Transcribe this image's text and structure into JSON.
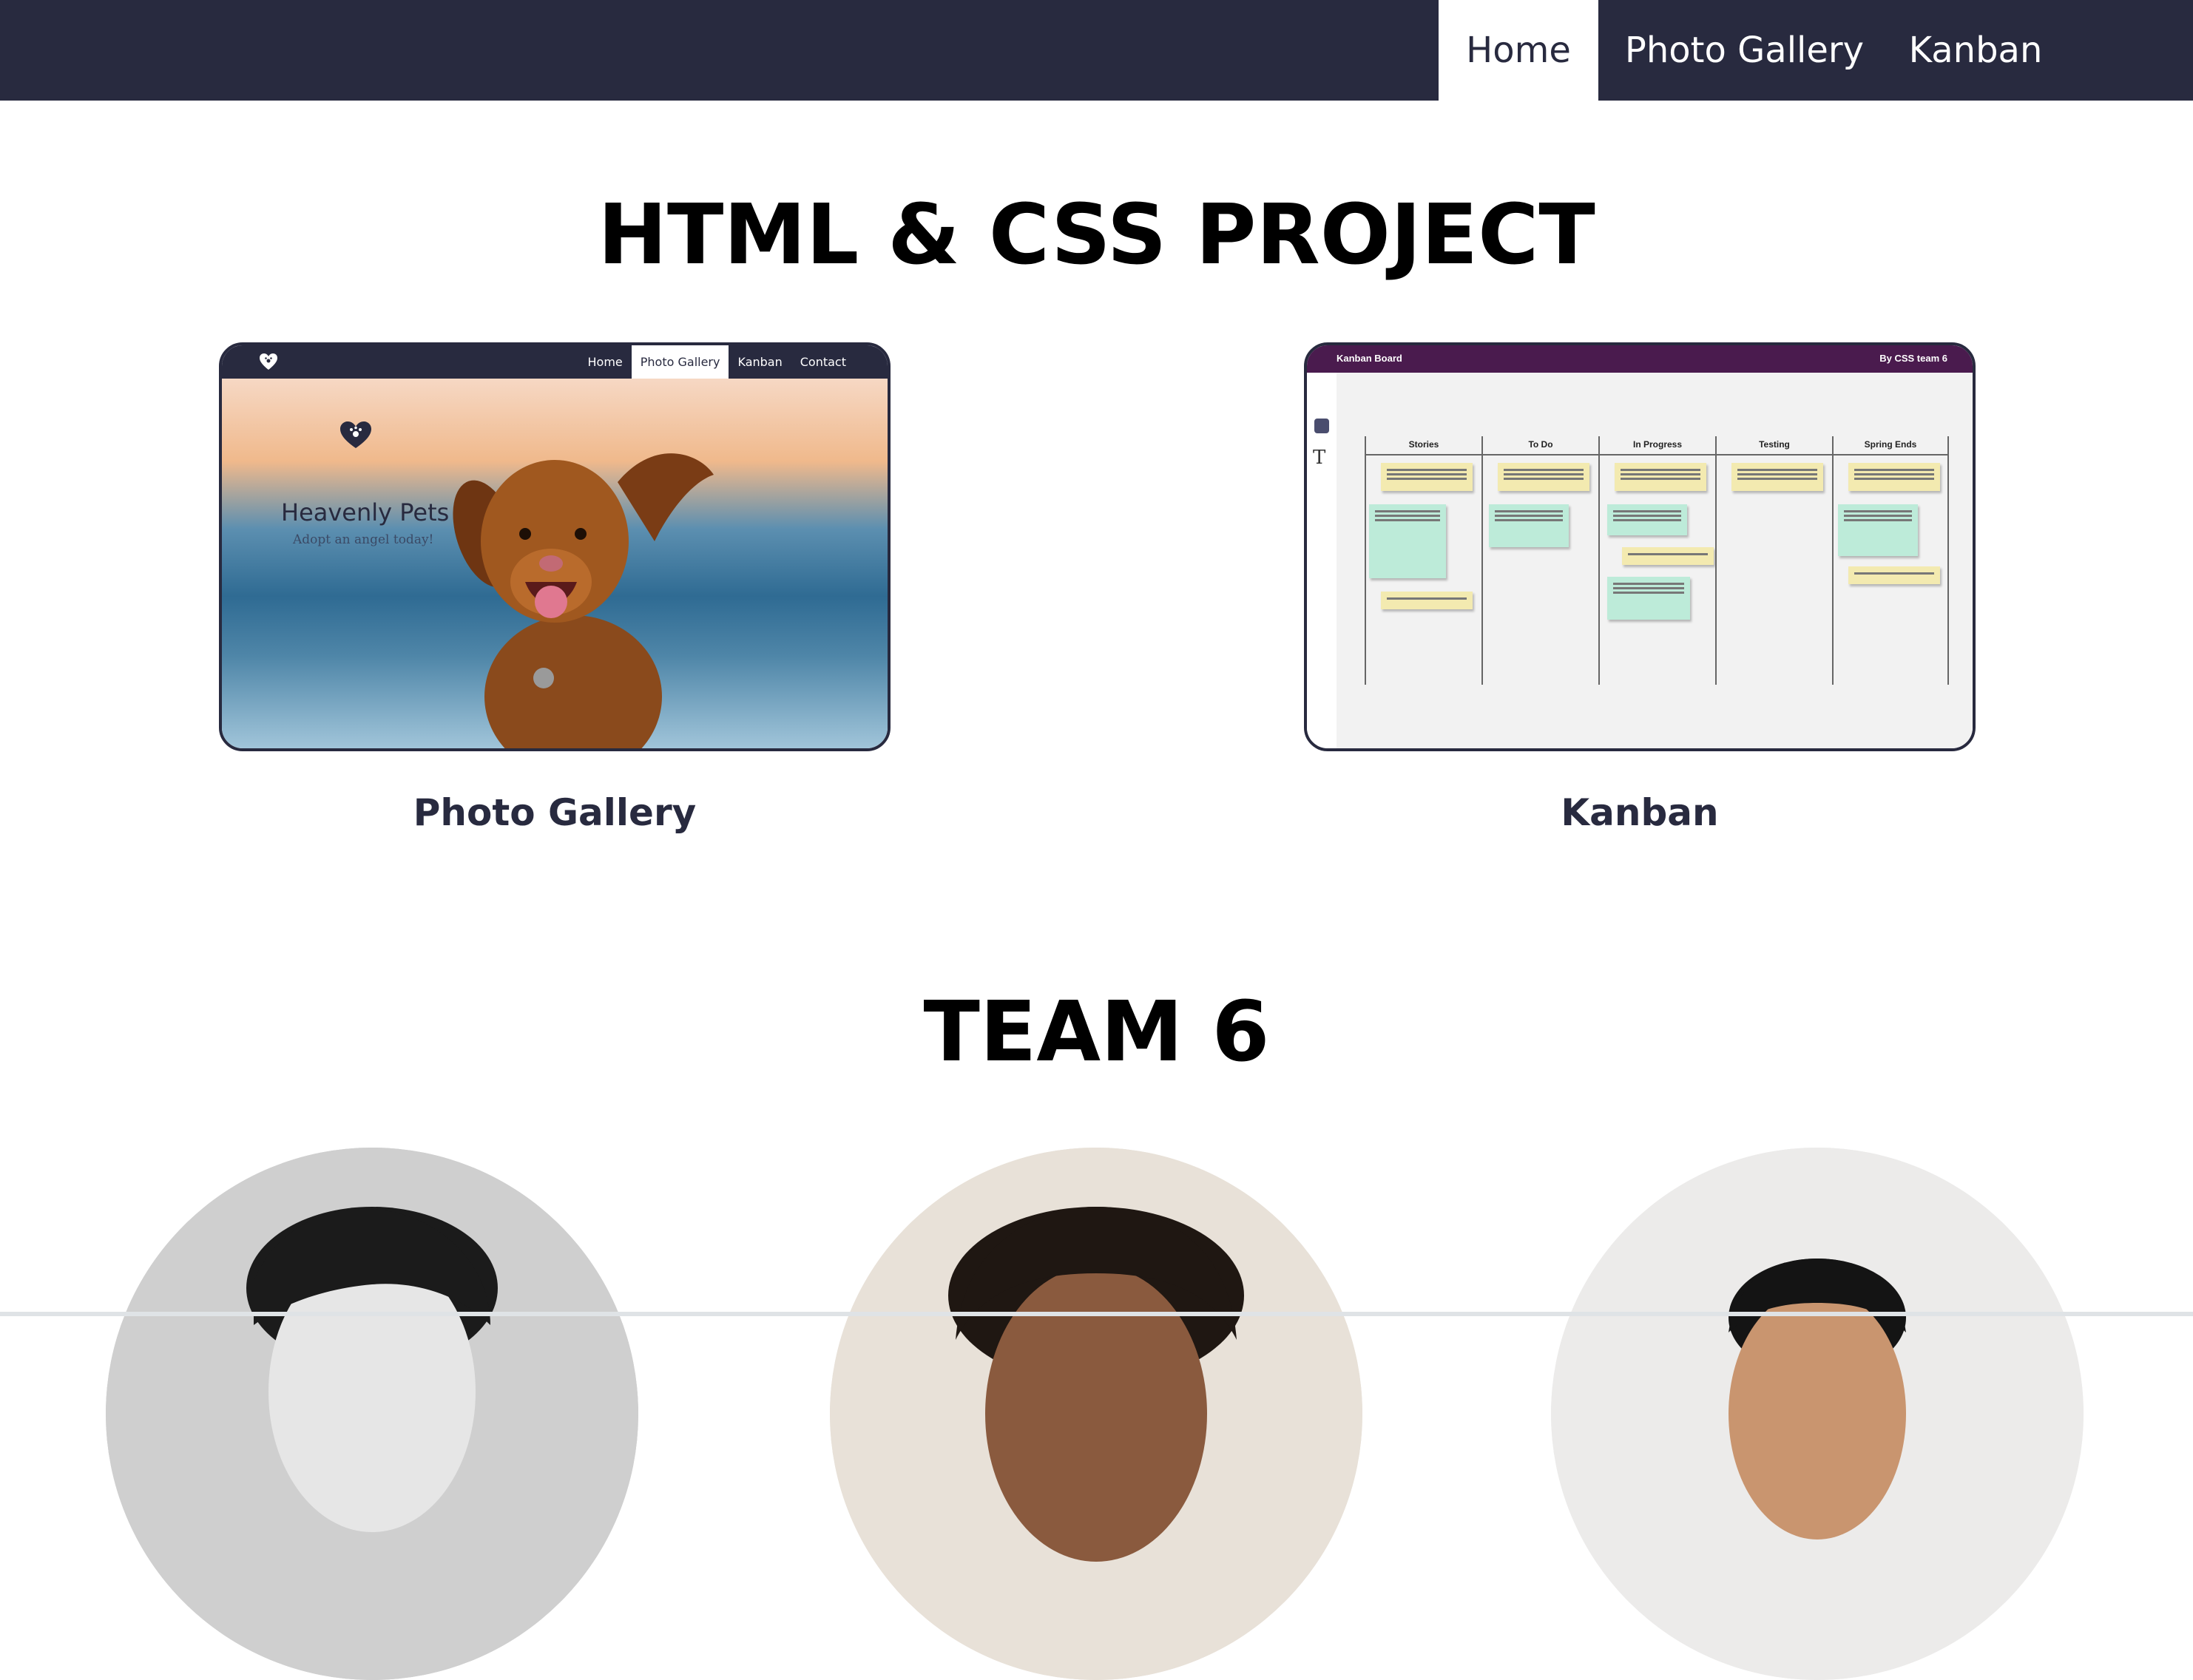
{
  "nav": {
    "items": [
      {
        "label": "Home",
        "active": true
      },
      {
        "label": "Photo Gallery",
        "active": false
      },
      {
        "label": "Kanban",
        "active": false
      }
    ]
  },
  "project": {
    "title": "HTML & CSS PROJECT",
    "cards": [
      {
        "caption": "Photo Gallery",
        "thumbnail": {
          "nav_items": [
            "Home",
            "Photo Gallery",
            "Kanban",
            "Contact"
          ],
          "active_nav": "Photo Gallery",
          "brand": "Heavenly Pets",
          "tagline": "Adopt an angel today!",
          "logo_icon": "heart-paw-icon"
        }
      },
      {
        "caption": "Kanban",
        "thumbnail": {
          "header_title": "Kanban Board",
          "header_by": "By CSS team 6",
          "columns": [
            "Stories",
            "To Do",
            "In Progress",
            "Testing",
            "Spring Ends"
          ],
          "header_color": "#4a1b4e"
        }
      }
    ]
  },
  "team": {
    "title": "TEAM 6",
    "members": [
      {
        "avatar": "team-member-photo-1"
      },
      {
        "avatar": "team-member-photo-2"
      },
      {
        "avatar": "team-member-photo-3"
      }
    ]
  },
  "colors": {
    "navbar": "#282a3f",
    "text_dark": "#282a3f",
    "heading": "#000000"
  }
}
